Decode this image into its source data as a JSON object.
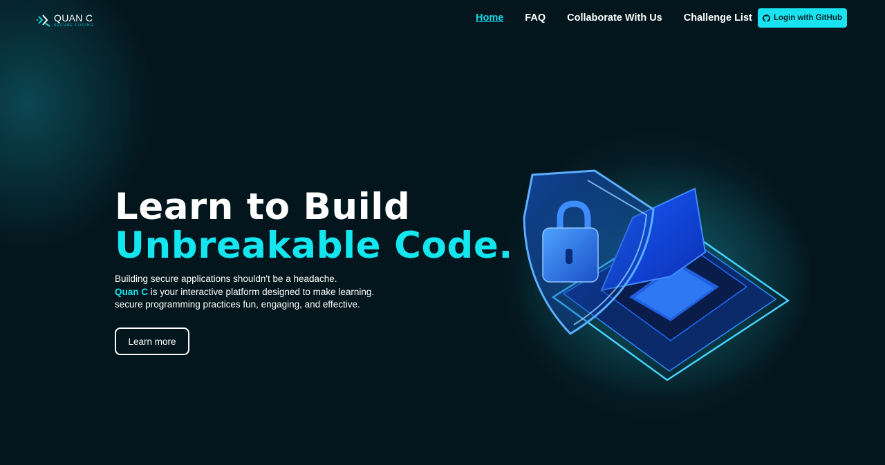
{
  "brand": {
    "name": "QUAN C",
    "tagline": "SECURE CODING"
  },
  "nav": {
    "items": [
      {
        "label": "Home",
        "active": true
      },
      {
        "label": "FAQ",
        "active": false
      },
      {
        "label": "Collaborate With Us",
        "active": false
      },
      {
        "label": "Challenge List",
        "active": false
      }
    ],
    "login_label": "Login with GitHub",
    "login_icon": "github-icon"
  },
  "hero": {
    "title_line1": "Learn to Build",
    "title_line2": "Unbreakable Code.",
    "desc_line1": "Building secure applications shouldn't be a headache.",
    "desc_brand": "Quan C",
    "desc_line2_rest": " is your interactive platform designed to make learning.",
    "desc_line3": "secure programming practices fun, engaging, and effective.",
    "cta_label": "Learn more"
  },
  "colors": {
    "background": "#04161d",
    "accent": "#14e6ef",
    "text": "#ffffff"
  }
}
